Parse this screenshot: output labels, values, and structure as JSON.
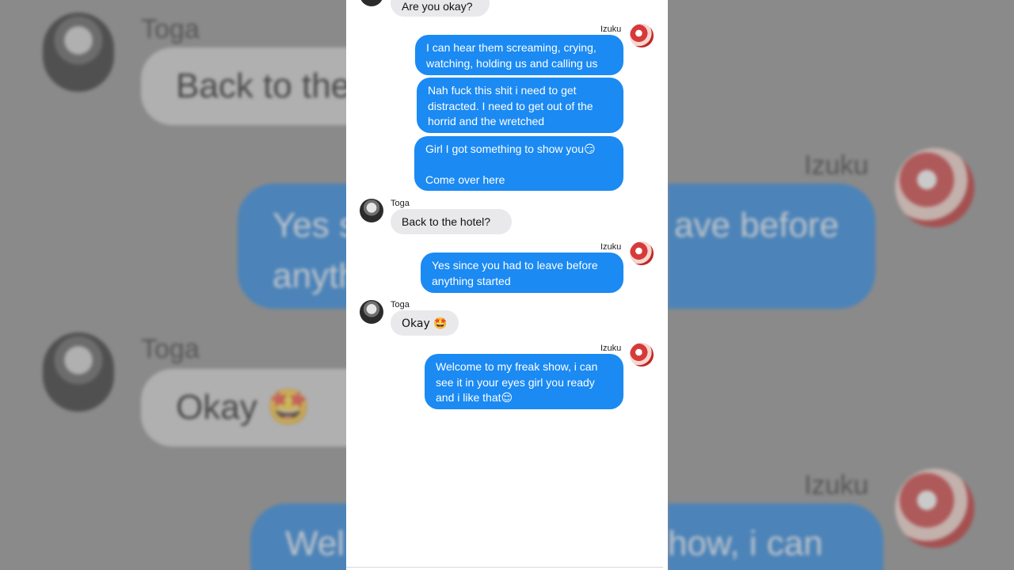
{
  "background": {
    "toga_name_1": "Toga",
    "toga_text_1": "Back to the",
    "izuku_name_1": "Izuku",
    "izuku_text_1a": "Yes s",
    "izuku_text_1b": "anyth",
    "izuku_text_1c": "ave before",
    "toga_name_2": "Toga",
    "toga_text_2": "Okay 🤩",
    "izuku_name_2": "Izuku",
    "izuku_text_2a": "Wel",
    "izuku_text_2b": "how, i can"
  },
  "chat": {
    "messages": [
      {
        "sender": "",
        "text": "Are you okay?"
      },
      {
        "sender": "Izuku",
        "text": "I can hear them screaming, crying, watching, holding us and calling us"
      },
      {
        "sender": "",
        "text": "Nah fuck this shit i need to get distracted. I need to get out of the horrid and the wretched"
      },
      {
        "sender": "",
        "text": "Girl I got something to show you😏\n\nCome over here"
      },
      {
        "sender": "Toga",
        "text": "Back to the hotel?"
      },
      {
        "sender": "Izuku",
        "text": "Yes since you had to leave before anything started"
      },
      {
        "sender": "Toga",
        "text": "Okay 🤩"
      },
      {
        "sender": "Izuku",
        "text": "Welcome to my freak show, i can see it in your eyes girl you ready and i like that😌"
      }
    ]
  },
  "colors": {
    "outgoing_bubble": "#1b8af3",
    "incoming_bubble": "#e9e9eb"
  }
}
